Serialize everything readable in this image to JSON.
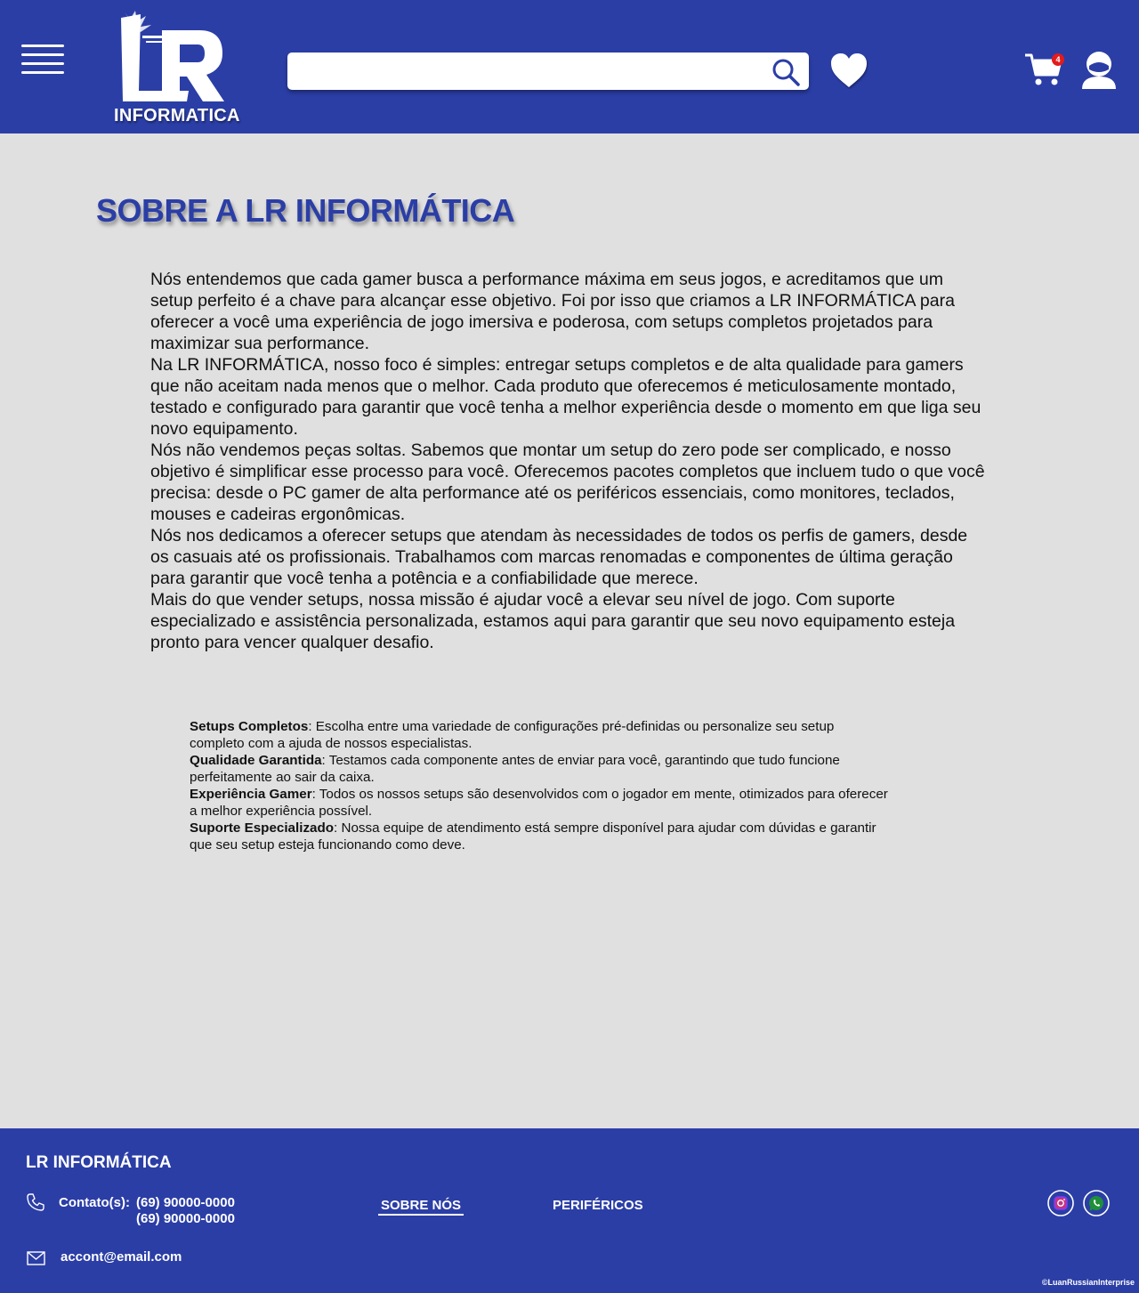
{
  "header": {
    "brand_text": "INFORMATICA",
    "cart_count": "4",
    "search": {
      "value": "",
      "placeholder": ""
    }
  },
  "main": {
    "title": "SOBRE A LR INFORMÁTICA",
    "paragraphs": [
      "Nós entendemos que cada gamer busca a performance máxima em seus jogos, e acreditamos que um setup perfeito é a chave para alcançar esse objetivo. Foi por isso que criamos a LR INFORMÁTICA para oferecer a você uma experiência de jogo imersiva e poderosa, com setups completos projetados para maximizar sua performance.",
      "Na LR INFORMÁTICA, nosso foco é simples: entregar setups completos e de alta qualidade para gamers que não aceitam nada menos que o melhor. Cada produto que oferecemos é meticulosamente montado, testado e configurado para garantir que você tenha a melhor experiência desde o momento em que liga seu novo equipamento.",
      "Nós não vendemos peças soltas. Sabemos que montar um setup do zero pode ser complicado, e nosso objetivo é simplificar esse processo para você. Oferecemos pacotes completos que incluem tudo o que você precisa: desde o PC gamer de alta performance até os periféricos essenciais, como monitores, teclados, mouses e cadeiras ergonômicas.",
      "Nós nos dedicamos a oferecer setups que atendam às necessidades de todos os perfis de gamers, desde os casuais até os profissionais. Trabalhamos com marcas renomadas e componentes de última geração para garantir que você tenha a potência e a confiabilidade que merece.",
      "Mais do que vender setups, nossa missão é ajudar você a elevar seu nível de jogo. Com suporte especializado e assistência personalizada, estamos aqui para garantir que seu novo equipamento esteja pronto para vencer qualquer desafio."
    ],
    "features": [
      {
        "title": "Setups Completos",
        "sep": ":",
        "text": " Escolha entre uma variedade de configurações pré-definidas ou personalize seu setup completo com a ajuda de nossos especialistas."
      },
      {
        "title": "Qualidade Garantida",
        "sep": ":",
        "text": " Testamos cada componente antes de enviar para você, garantindo que tudo funcione perfeitamente ao sair da caixa."
      },
      {
        "title": "Experiência Gamer",
        "sep": ":",
        "text": " Todos os nossos setups são desenvolvidos com o jogador em mente, otimizados para oferecer a melhor experiência possível."
      },
      {
        "title": "Suporte Especializado",
        "sep": ":",
        "text": " Nossa equipe de atendimento está sempre disponível para ajudar com dúvidas e garantir que seu setup esteja funcionando como deve."
      }
    ]
  },
  "footer": {
    "brand": "LR INFORMÁTICA",
    "contact_label": "Contato(s):",
    "phones": [
      "(69) 90000-0000",
      "(69) 90000-0000"
    ],
    "email": "accont@email.com",
    "nav": {
      "about": "SOBRE NÓS",
      "peripherals": "PERIFÉRICOS"
    },
    "copyright": "©LuanRussianInterprise"
  },
  "colors": {
    "primary": "#2b3ea6",
    "background": "#e0e0e0",
    "badge": "#e31b1b",
    "instagram": "#c13584",
    "whatsapp": "#25d366"
  },
  "icons": [
    "menu-icon",
    "logo",
    "search-icon",
    "heart-icon",
    "cart-icon",
    "user-icon",
    "phone-icon",
    "mail-icon",
    "instagram-icon",
    "whatsapp-icon"
  ]
}
